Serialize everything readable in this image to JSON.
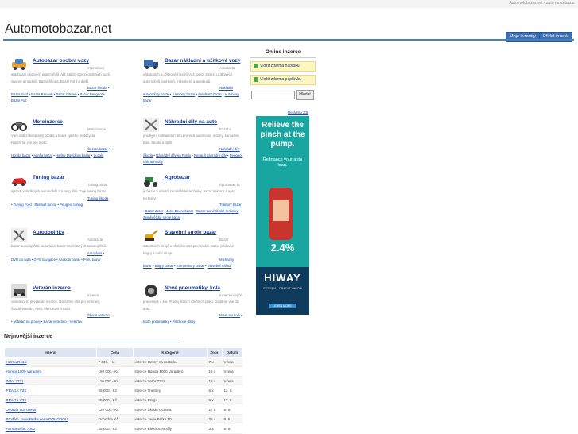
{
  "topbar": {
    "tag": "Automotobazar.net - auto moto bazar"
  },
  "header": {
    "logo": "Automotobazar.net",
    "btn_my": "Moje inzeráty",
    "btn_add": "Přidat inzerát"
  },
  "categories": [
    {
      "title": "Autobazar osobní vozy",
      "desc": "Internetový autobazar osobních automobilů Váš nabízí inzerci osobních vozů značek a modelů. Bazar Škoda, Bazar Ford a další.",
      "links": [
        "Bazar Škoda",
        "Bazar Ford",
        "Bazar Renault",
        "Bazar Citroen",
        "Bazar Peugeot",
        "Bazar Fiat"
      ]
    },
    {
      "title": "Bazar nákladní a užitkové vozy",
      "desc": "Autobazar nákladních a užitkových vozů Váš nabízí inzerci užitkových automobilů, kamionů, mikrobusů a autobusů.",
      "links": [
        "Nákladní automobily bazar",
        "Kamiony bazar",
        "Autobusy bazar",
        "Autobusy bazar"
      ]
    },
    {
      "title": "Motoinzerce",
      "desc": "Motoinzerce Vám nabízí bezplatný prodej a koupi sjetého motocyklu. Nabízíme vše pro moto.",
      "links": [
        "Čezeta bazar",
        "Honda bazar",
        "Aprilia bazar",
        "Harley Davidson bazar",
        "Suzuki"
      ]
    },
    {
      "title": "Náhradní díly na auto",
      "desc": "Bazar s prodejem náhradních dílů pro Vaši automobil, motory, karosérie, kola. Škoda a další.",
      "links": [
        "Náhradní díly Škoda",
        "Náhradní díly na Fordu",
        "Renault náhradní díly",
        "Peugeot náhradní díly"
      ]
    },
    {
      "title": "Tuning bazar",
      "desc": "Tuning bazar sjetých vyladěných automobilů a tuning dílů. To je tuning bazar.",
      "links": [
        "Tuning Škoda",
        "Tuning Ford",
        "Renault tuning",
        "Peugeot tuning"
      ]
    },
    {
      "title": "Agrobazar",
      "desc": "Agrobazar, to je bazar s inzercí zemědělské techniky, bazar traktorů a agro techniky.",
      "links": [
        "Traktory bazar",
        "Bazar Zetor",
        "John Deere bazar",
        "Bazar zemědělské techniky",
        "Zemědělské stroje bazar"
      ]
    },
    {
      "title": "Autodoplňky",
      "desc": "Autobazar, bazar autodoplňků, autorádia, bazar interiérových autodoplňků.",
      "links": [
        "Autorádia",
        "DVD do auta",
        "GPS navigace",
        "Alu kola bazar",
        "Pneu bazar"
      ]
    },
    {
      "title": "Stavební stroje bazar",
      "desc": "Bazar stavebních strojů a příslušenství pro stavbu. Bazar přídavné bagry a další stroje.",
      "links": [
        "Míchačky bazar",
        "Bagry bazar",
        "Kompresory bazar",
        "Stavební nářadí"
      ]
    },
    {
      "title": "Veterán inzerce",
      "desc": "Inzerce veteránů, to je veterán inzerce. Nabízíme vše pro veterány, Škoda veterán, Aero, Mercedes a další.",
      "links": [
        "Škoda veterán",
        "Veterán na prodej",
        "Bazar veteránů",
        "Veteráni"
      ]
    },
    {
      "title": "Nové pneumatiky, kola",
      "desc": "Inzerce nových pneumatik a kol. Prodej letních i zimních pneu. Dodáme vše do auta.",
      "links": [
        "Nové alu kola",
        "Moto pneumatiky",
        "Plechové disky"
      ]
    }
  ],
  "online": {
    "heading": "Online inzerce",
    "btn_offer": "Vložit zdarma nabídku",
    "btn_demand": "Vložit zdarma poptávku",
    "search_btn": "Hledat",
    "ad_label": "Reklama zde"
  },
  "ad": {
    "headline": "Relieve the pinch at the pump.",
    "sub": "Refinance your auto loan.",
    "rate": "2.4%",
    "brand": "HIWAY",
    "brand_sub": "FEDERAL CREDIT UNION",
    "cta": "LEARN MORE"
  },
  "newest": {
    "heading": "Nejnovější inzerce",
    "columns": [
      "Inzerát",
      "Cena",
      "Kategorie",
      "Zobr.",
      "Datum"
    ],
    "rows": [
      [
        "Helma Rossi",
        "7 000,- Kč",
        "inzerce Helmy na motorku",
        "7 x",
        "Včera"
      ],
      [
        "Honda 1000 Varadero",
        "180 000,- Kč",
        "inzerce Honda 1000 Varadero",
        "16 x",
        "Včera"
      ],
      [
        "Zetor 7711",
        "110 000,- Kč",
        "inzerce Zetor 7711",
        "16 x",
        "Včera"
      ],
      [
        "PRAGA V3S",
        "55 000,- Kč",
        "inzerce Traktory",
        "6 x",
        "11. 6."
      ],
      [
        "PRAGA V3S",
        "55 000,- Kč",
        "inzerce Praga",
        "9 x",
        "11. 6."
      ],
      [
        "Octavia TDI combi",
        "120 000,- Kč",
        "inzerce Škoda Octavia",
        "17 x",
        "9. 6."
      ],
      [
        "Prodám Jawa Betka cena DOHODOU",
        "Dohodou Kč",
        "inzerce Jawa Betka 50",
        "25 x",
        "9. 6."
      ],
      [
        "Honda Eclnt 7000",
        "25 000,- Kč",
        "inzerce Elektrocentrály",
        "3 x",
        "9. 6."
      ]
    ]
  }
}
